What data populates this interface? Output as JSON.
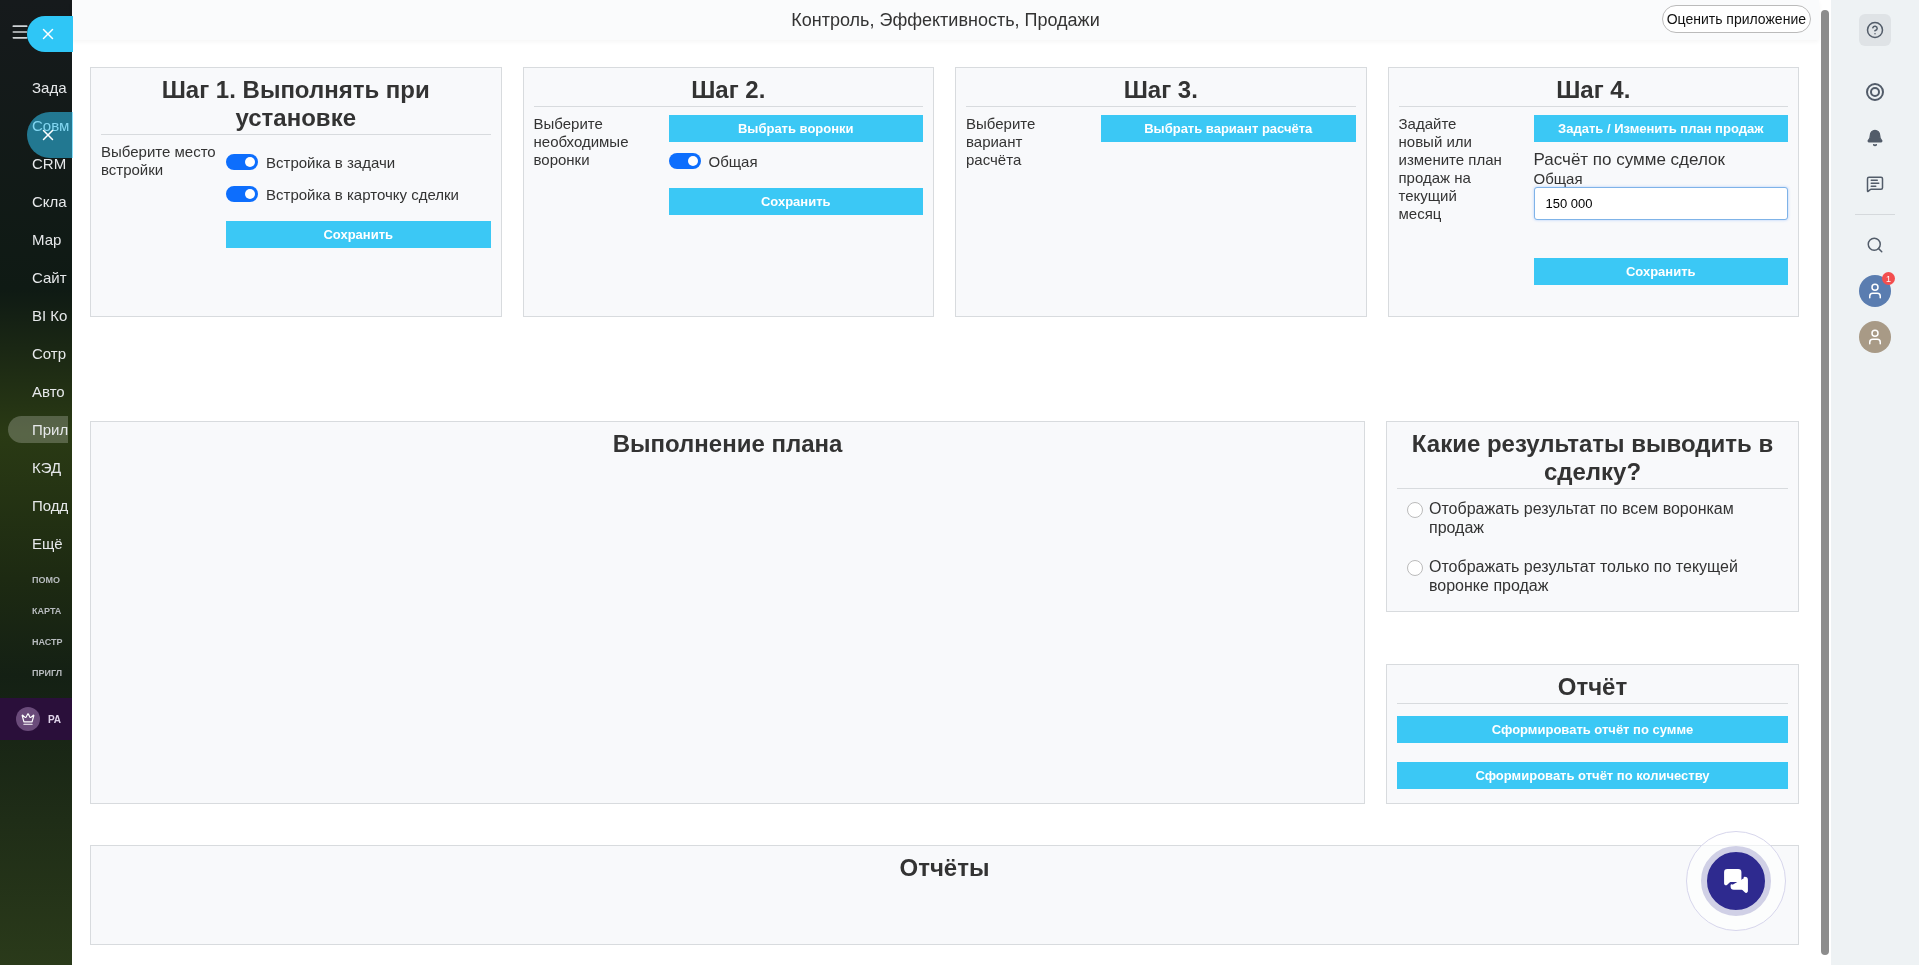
{
  "nav": {
    "items": [
      {
        "label": "Зада",
        "selected": false
      },
      {
        "label": "Совм",
        "selected": false
      },
      {
        "label": "CRM",
        "selected": false
      },
      {
        "label": "Скла",
        "selected": false
      },
      {
        "label": "Мар",
        "selected": false
      },
      {
        "label": "Сайт",
        "selected": false
      },
      {
        "label": "BI Ко",
        "selected": false
      },
      {
        "label": "Сотр",
        "selected": false
      },
      {
        "label": "Авто",
        "selected": false
      },
      {
        "label": "Прил",
        "selected": true
      },
      {
        "label": "КЭД",
        "selected": false
      },
      {
        "label": "Подд",
        "selected": false
      },
      {
        "label": "Ещё",
        "selected": false
      }
    ],
    "footer_items": [
      "ПОМО",
      "КАРТА",
      "НАСТР",
      "ПРИГЛ"
    ],
    "upgrade_label": "РА"
  },
  "header": {
    "title": "Контроль, Эффективность, Продажи",
    "rate_button": "Оценить приложение"
  },
  "steps": [
    {
      "title": "Шаг 1. Выполнять при установке",
      "description": "Выберите место встройки",
      "toggles": [
        {
          "label": "Встройка в задачи",
          "on": true
        },
        {
          "label": "Встройка в карточку сделки",
          "on": true
        }
      ],
      "save_button": "Сохранить"
    },
    {
      "title": "Шаг 2.",
      "description": "Выберите необходимые воронки",
      "action_button": "Выбрать воронки",
      "toggles": [
        {
          "label": "Общая",
          "on": true
        }
      ],
      "save_button": "Сохранить"
    },
    {
      "title": "Шаг 3.",
      "description": "Выберите вариант расчёта",
      "action_button": "Выбрать вариант расчёта"
    },
    {
      "title": "Шаг 4.",
      "description": "Задайте новый или измените план продаж на текущий месяц",
      "action_button": "Задать / Изменить план продаж",
      "plan": {
        "calc_label": "Расчёт по сумме сделок",
        "funnel_label": "Общая",
        "value": "150 000"
      },
      "save_button": "Сохранить"
    }
  ],
  "plan_progress": {
    "title": "Выполнение плана"
  },
  "results": {
    "title": "Какие результаты выводить в сделку?",
    "options": [
      {
        "label": "Отображать результат по всем воронкам продаж",
        "selected": false
      },
      {
        "label": "Отображать результат только по текущей воронке продаж",
        "selected": false
      }
    ]
  },
  "report": {
    "title": "Отчёт",
    "buttons": [
      "Сформировать отчёт по сумме",
      "Сформировать отчёт по количеству"
    ]
  },
  "reports": {
    "title": "Отчёты"
  },
  "right_bar": {
    "avatar_badge": "1"
  }
}
